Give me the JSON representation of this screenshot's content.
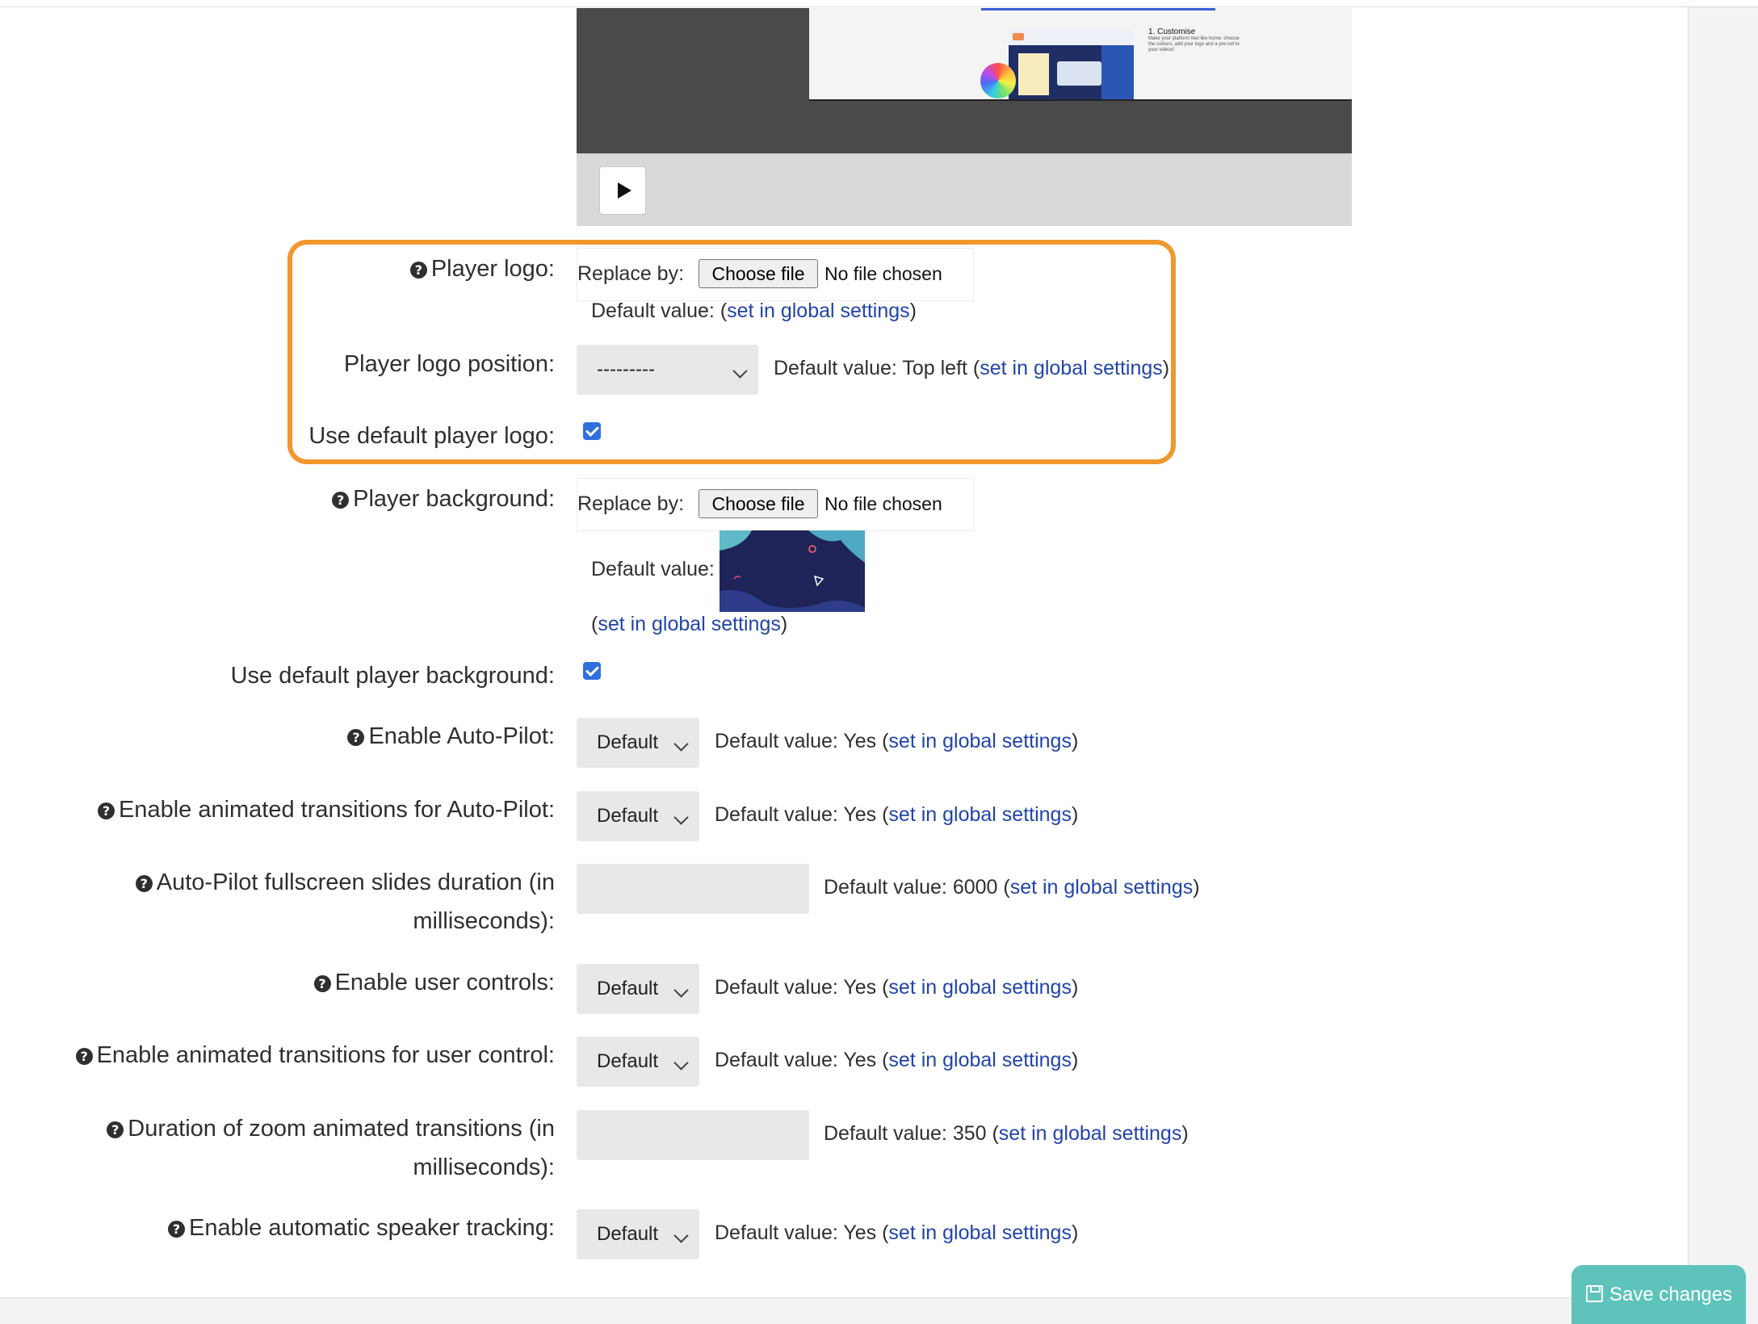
{
  "video": {
    "thumb_caption_title": "1. Customise",
    "thumb_caption_body": "Make your platform feel like home: choose the colours, add your logo and a pre-roll to your videos!"
  },
  "common": {
    "replace_by": "Replace by:",
    "choose_file": "Choose file",
    "no_file": "No file chosen",
    "set_global": "set in global settings",
    "default_select": "Default"
  },
  "fields": {
    "player_logo": {
      "label": "Player logo:",
      "default_prefix": "Default value: (",
      "default_suffix": ")"
    },
    "player_logo_position": {
      "label": "Player logo position:",
      "value": "---------",
      "default_prefix": "Default value: Top left (",
      "default_suffix": ")"
    },
    "use_default_player_logo": {
      "label": "Use default player logo:",
      "checked": true
    },
    "player_background": {
      "label": "Player background:",
      "default_prefix": "Default value:",
      "link_prefix": "(",
      "link_suffix": ")"
    },
    "use_default_player_background": {
      "label": "Use default player background:",
      "checked": true
    },
    "enable_autopilot": {
      "label": "Enable Auto-Pilot:",
      "default_prefix": "Default value: Yes (",
      "default_suffix": ")"
    },
    "enable_anim_autopilot": {
      "label": "Enable animated transitions for Auto-Pilot:",
      "default_prefix": "Default value: Yes (",
      "default_suffix": ")"
    },
    "autopilot_duration": {
      "label_line1": "Auto-Pilot fullscreen slides duration (in",
      "label_line2": "milliseconds):",
      "default_prefix": "Default value: 6000 (",
      "default_suffix": ")"
    },
    "enable_user_controls": {
      "label": "Enable user controls:",
      "default_prefix": "Default value: Yes (",
      "default_suffix": ")"
    },
    "enable_anim_user": {
      "label": "Enable animated transitions for user control:",
      "default_prefix": "Default value: Yes (",
      "default_suffix": ")"
    },
    "zoom_duration": {
      "label_line1": "Duration of zoom animated transitions (in",
      "label_line2": "milliseconds):",
      "default_prefix": "Default value: 350 (",
      "default_suffix": ")"
    },
    "speaker_tracking": {
      "label": "Enable automatic speaker tracking:",
      "default_prefix": "Default value: Yes (",
      "default_suffix": ")"
    }
  },
  "save_button": {
    "label": "Save changes"
  },
  "colors": {
    "highlight": "#f0972e",
    "link": "#2244aa",
    "save": "#5ec4bb",
    "checkbox": "#2f6fdf"
  }
}
